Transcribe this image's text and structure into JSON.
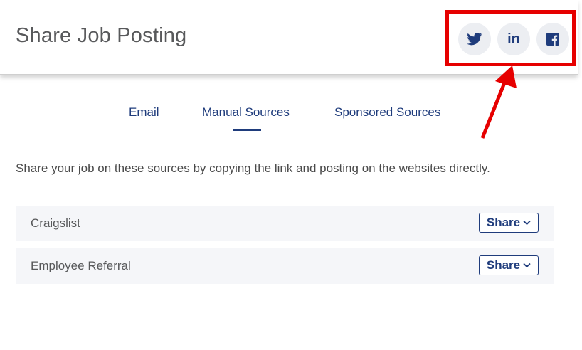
{
  "header": {
    "title": "Share Job Posting",
    "social": [
      {
        "name": "twitter",
        "icon": "twitter-icon"
      },
      {
        "name": "linkedin",
        "icon": "linkedin-icon",
        "glyph": "in"
      },
      {
        "name": "facebook",
        "icon": "facebook-icon"
      }
    ]
  },
  "tabs": [
    {
      "label": "Email"
    },
    {
      "label": "Manual Sources",
      "active": true
    },
    {
      "label": "Sponsored Sources"
    }
  ],
  "description": "Share your job on these sources by copying the link and posting on the websites directly.",
  "sources": [
    {
      "label": "Craigslist",
      "button": "Share"
    },
    {
      "label": "Employee Referral",
      "button": "Share"
    }
  ],
  "colors": {
    "primary": "#1f3c7c",
    "annotation": "#e60000",
    "row_bg": "#f5f6f9",
    "icon_bg": "#eceef2"
  }
}
